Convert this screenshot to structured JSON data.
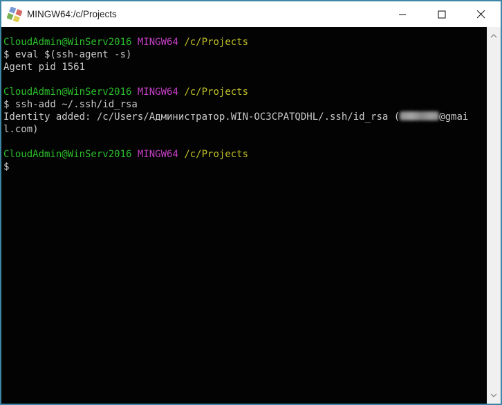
{
  "window": {
    "title": "MINGW64:/c/Projects",
    "border_color": "#3e86a5",
    "app_icon": "msys-diamond-icon",
    "controls": [
      {
        "name": "minimize",
        "icon": "minimize-icon"
      },
      {
        "name": "maximize",
        "icon": "maximize-icon"
      },
      {
        "name": "close",
        "icon": "close-icon"
      }
    ]
  },
  "terminal": {
    "colors": {
      "background": "#030303",
      "fg": "#c9c9c9",
      "green": "#2bbd2b",
      "magenta": "#c33fc3",
      "yellow": "#c0c028"
    },
    "lines": [
      {
        "segments": [
          {
            "n": "prompt-user-host",
            "t": "CloudAdmin@WinServ2016",
            "c": "green"
          },
          {
            "n": "separator",
            "t": " ",
            "c": "fg"
          },
          {
            "n": "prompt-msystem",
            "t": "MINGW64",
            "c": "magenta"
          },
          {
            "n": "separator",
            "t": " ",
            "c": "fg"
          },
          {
            "n": "prompt-cwd",
            "t": "/c/Projects",
            "c": "yellow"
          }
        ]
      },
      {
        "segments": [
          {
            "n": "command-text",
            "t": "$ eval $(ssh-agent -s)",
            "c": "fg"
          }
        ]
      },
      {
        "segments": [
          {
            "n": "output-text",
            "t": "Agent pid 1561",
            "c": "fg"
          }
        ]
      },
      {
        "segments": []
      },
      {
        "segments": [
          {
            "n": "prompt-user-host",
            "t": "CloudAdmin@WinServ2016",
            "c": "green"
          },
          {
            "n": "separator",
            "t": " ",
            "c": "fg"
          },
          {
            "n": "prompt-msystem",
            "t": "MINGW64",
            "c": "magenta"
          },
          {
            "n": "separator",
            "t": " ",
            "c": "fg"
          },
          {
            "n": "prompt-cwd",
            "t": "/c/Projects",
            "c": "yellow"
          }
        ]
      },
      {
        "segments": [
          {
            "n": "command-text",
            "t": "$ ssh-add ~/.ssh/id_rsa",
            "c": "fg"
          }
        ]
      },
      {
        "segments": [
          {
            "n": "output-text",
            "t": "Identity added: /c/Users/Администратор.WIN-OC3CPATQDHL/.ssh/id_rsa (",
            "c": "fg"
          },
          {
            "n": "redacted-email",
            "blur": true
          },
          {
            "n": "output-text",
            "t": "@gmai",
            "c": "fg"
          }
        ]
      },
      {
        "segments": [
          {
            "n": "output-text",
            "t": "l.com)",
            "c": "fg"
          }
        ]
      },
      {
        "segments": []
      },
      {
        "segments": [
          {
            "n": "prompt-user-host",
            "t": "CloudAdmin@WinServ2016",
            "c": "green"
          },
          {
            "n": "separator",
            "t": " ",
            "c": "fg"
          },
          {
            "n": "prompt-msystem",
            "t": "MINGW64",
            "c": "magenta"
          },
          {
            "n": "separator",
            "t": " ",
            "c": "fg"
          },
          {
            "n": "prompt-cwd",
            "t": "/c/Projects",
            "c": "yellow"
          }
        ]
      },
      {
        "segments": [
          {
            "n": "command-text",
            "t": "$",
            "c": "fg"
          }
        ]
      }
    ]
  },
  "scrollbar": {
    "up_icon": "chevron-up-icon",
    "down_icon": "chevron-down-icon"
  }
}
